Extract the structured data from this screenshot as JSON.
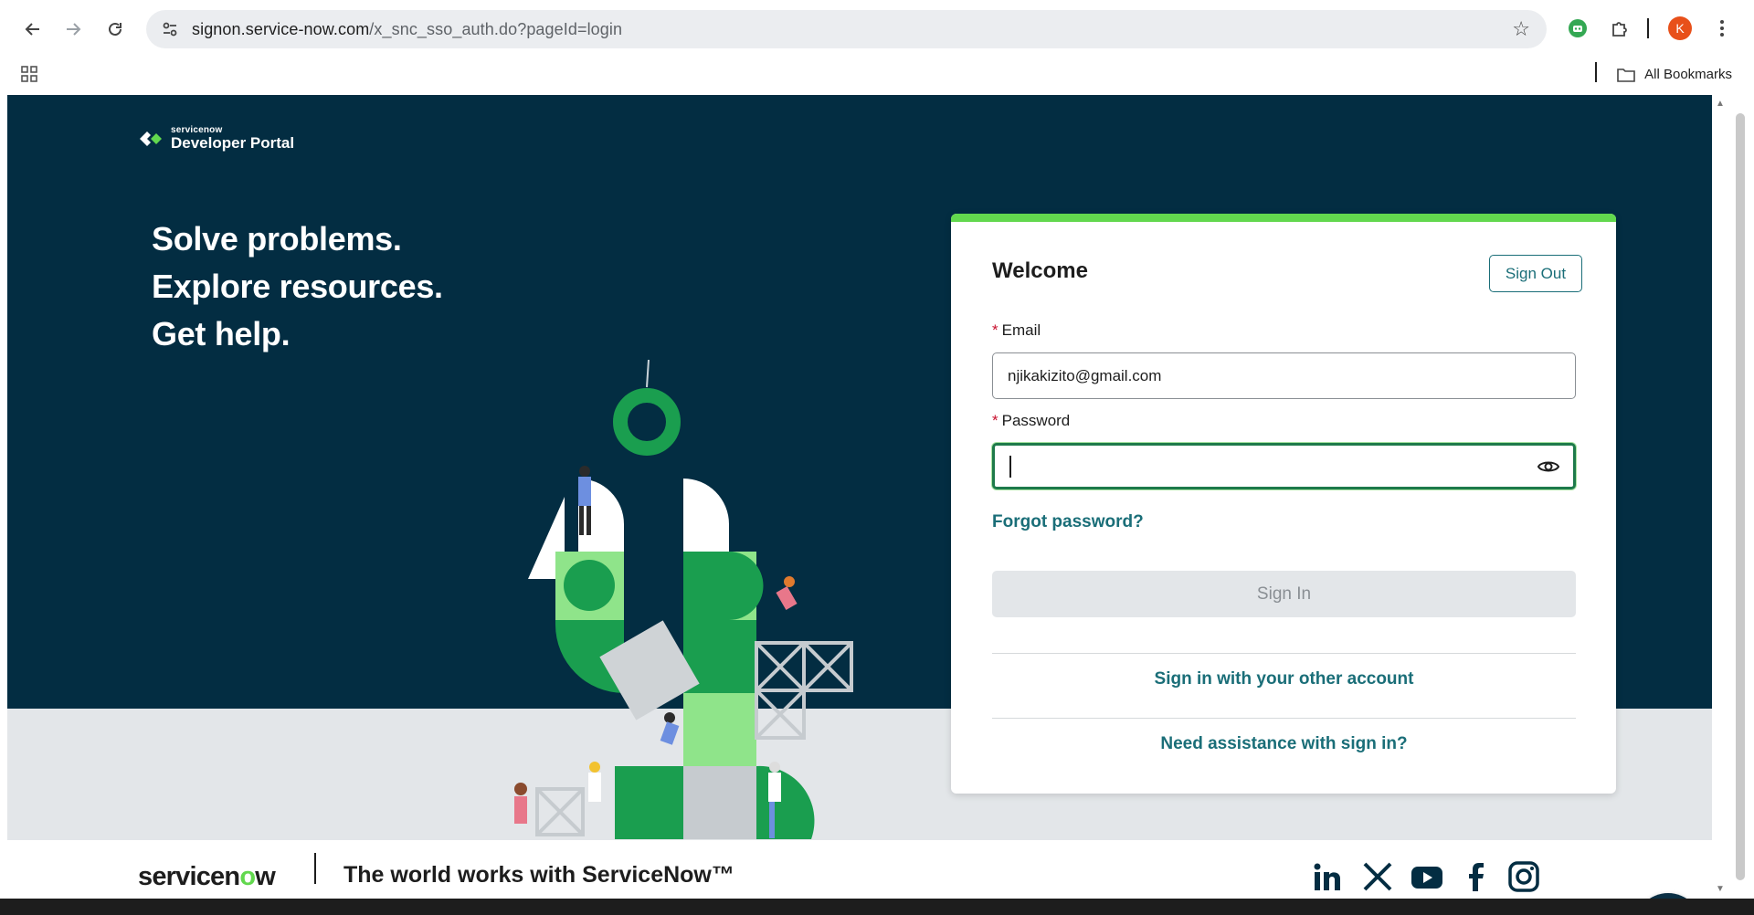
{
  "browser": {
    "url_host": "signon.service-now.com",
    "url_path": "/x_snc_sso_auth.do?pageId=login",
    "avatar_letter": "K",
    "all_bookmarks": "All Bookmarks"
  },
  "brand": {
    "logo_small": "servicenow",
    "logo_big": "Developer Portal"
  },
  "hero": {
    "lines": [
      "Solve problems.",
      "Explore resources.",
      "Get help."
    ]
  },
  "login": {
    "title": "Welcome",
    "sign_out": "Sign Out",
    "email_label": "Email",
    "email_value": "njikakizito@gmail.com",
    "password_label": "Password",
    "required_mark": "*",
    "forgot": "Forgot password?",
    "sign_in": "Sign In",
    "other_account": "Sign in with your other account",
    "assistance": "Need assistance with sign in?"
  },
  "footer": {
    "logo_text_a": "servicen",
    "logo_text_o": "o",
    "logo_text_b": "w",
    "tagline": "The world works with ServiceNow™"
  },
  "colors": {
    "page_bg": "#032d42",
    "accent_green": "#62d84e",
    "link_teal": "#1a6e78"
  }
}
